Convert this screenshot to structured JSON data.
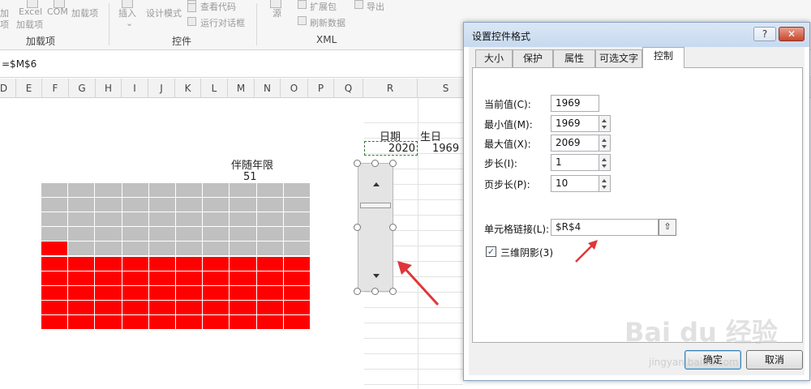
{
  "ribbon": {
    "items": [
      {
        "label": "加",
        "x": "left"
      },
      {
        "label": "项"
      },
      {
        "label": "Excel"
      },
      {
        "label": "加载项"
      },
      {
        "label": "COM"
      },
      {
        "label": "加载项"
      }
    ],
    "insert_label": "插入",
    "design_mode_label": "设计模式",
    "view_code_label": "查看代码",
    "run_dialog_label": "运行对话框",
    "source_label": "源",
    "expansion_pack_label": "扩展包",
    "refresh_data_label": "刷新数据",
    "export_label": "导出",
    "groups": [
      "加载项",
      "控件",
      "XML"
    ]
  },
  "formula_bar": {
    "formula": "=$M$6"
  },
  "columns": [
    "D",
    "E",
    "F",
    "G",
    "H",
    "I",
    "J",
    "K",
    "L",
    "M",
    "N",
    "O",
    "P",
    "Q",
    "R",
    "S"
  ],
  "sheet": {
    "title_label": "伴随年限",
    "title_value": "51",
    "date_header": "日期",
    "birth_header": "生日",
    "date_value": "2020",
    "birth_value": "1969"
  },
  "grid_chart": {
    "rows": 10,
    "cols": 10,
    "filled": 51,
    "fill_color": "#ff0000",
    "empty_color": "#c0c0c0"
  },
  "dialog": {
    "title": "设置控件格式",
    "help_label": "?",
    "close_label": "✕",
    "tabs": [
      "大小",
      "保护",
      "属性",
      "可选文字",
      "控制"
    ],
    "active_tab": "控制",
    "fields": [
      {
        "label": "当前值(C):",
        "value": "1969",
        "spin": false
      },
      {
        "label": "最小值(M):",
        "value": "1969",
        "spin": true
      },
      {
        "label": "最大值(X):",
        "value": "2069",
        "spin": true
      },
      {
        "label": "步长(I):",
        "value": "1",
        "spin": true
      },
      {
        "label": "页步长(P):",
        "value": "10",
        "spin": true
      }
    ],
    "link_label": "单元格链接(L):",
    "link_value": "$R$4",
    "link_button_icon": "collapse-dialog-icon",
    "shadow_label": "三维阴影(3)",
    "shadow_checked": true,
    "ok_label": "确定",
    "cancel_label": "取消"
  },
  "watermark": {
    "logo": "Bai du 经验",
    "url": "jingyan.baidu.com"
  },
  "colors": {
    "annotation": "#e0363a",
    "selection": "#2e7d32"
  }
}
